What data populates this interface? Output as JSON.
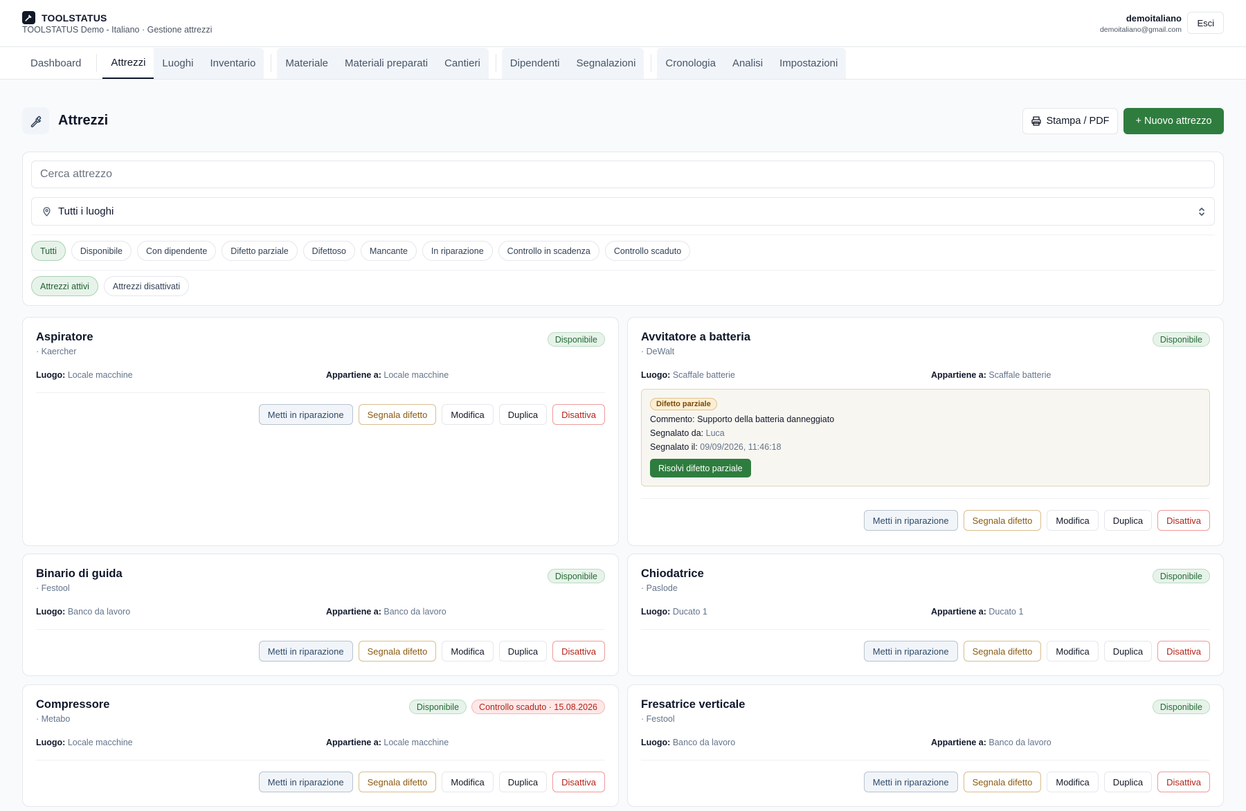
{
  "app": {
    "name": "TOOLSTATUS",
    "subtitle": "TOOLSTATUS Demo - Italiano · Gestione attrezzi",
    "user_name": "demoitaliano",
    "user_email": "demoitaliano@gmail.com",
    "logout_label": "Esci"
  },
  "nav": {
    "tabs": [
      "Dashboard",
      "Attrezzi",
      "Luoghi",
      "Inventario",
      "Materiale",
      "Materiali preparati",
      "Cantieri",
      "Dipendenti",
      "Segnalazioni",
      "Cronologia",
      "Analisi",
      "Impostazioni"
    ],
    "active": "Attrezzi"
  },
  "page": {
    "title": "Attrezzi",
    "title_icon": "wrench-icon",
    "print_label": "Stampa / PDF",
    "new_label": "+ Nuovo attrezzo"
  },
  "filters": {
    "search_placeholder": "Cerca attrezzo",
    "location_value": "Tutti i luoghi",
    "status_chips": [
      "Tutti",
      "Disponibile",
      "Con dipendente",
      "Difetto parziale",
      "Difettoso",
      "Mancante",
      "In riparazione",
      "Controllo in scadenza",
      "Controllo scaduto"
    ],
    "status_selected": "Tutti",
    "active_chips": [
      "Attrezzi attivi",
      "Attrezzi disattivati"
    ],
    "active_selected": "Attrezzi attivi"
  },
  "labels": {
    "location": "Luogo:",
    "owner": "Appartiene a:",
    "comment": "Commento:",
    "reported_by": "Segnalato da:",
    "reported_at": "Segnalato il:"
  },
  "actions": {
    "repair": "Metti in riparazione",
    "report": "Segnala difetto",
    "edit": "Modifica",
    "duplicate": "Duplica",
    "deactivate": "Disattiva"
  },
  "colors": {
    "primary": "#2e7d3e",
    "ok_badge": "#e7f3ea",
    "bad_badge": "#fde8e8",
    "defect_box": "#f8f6f1"
  },
  "tools": [
    {
      "name": "Aspiratore",
      "brand": "· Kaercher",
      "location": "Locale macchine",
      "owner": "Locale macchine",
      "badges": [
        "Disponibile"
      ]
    },
    {
      "name": "Avvitatore a batteria",
      "brand": "· DeWalt",
      "location": "Scaffale batterie",
      "owner": "Scaffale batterie",
      "badges": [
        "Disponibile"
      ],
      "defect": {
        "type": "Difetto parziale",
        "comment": "Supporto della batteria danneggiato",
        "reported_by": "Luca",
        "reported_at": "09/09/2026, 11:46:18",
        "resolve_label": "Risolvi difetto parziale"
      }
    },
    {
      "name": "Binario di guida",
      "brand": "· Festool",
      "location": "Banco da lavoro",
      "owner": "Banco da lavoro",
      "badges": [
        "Disponibile"
      ]
    },
    {
      "name": "Chiodatrice",
      "brand": "· Paslode",
      "location": "Ducato 1",
      "owner": "Ducato 1",
      "badges": [
        "Disponibile"
      ]
    },
    {
      "name": "Compressore",
      "brand": "· Metabo",
      "location": "Locale macchine",
      "owner": "Locale macchine",
      "badges": [
        "Disponibile",
        "Controllo scaduto · 15.08.2026"
      ]
    },
    {
      "name": "Fresatrice verticale",
      "brand": "· Festool",
      "location": "Banco da lavoro",
      "owner": "Banco da lavoro",
      "badges": [
        "Disponibile"
      ]
    }
  ]
}
